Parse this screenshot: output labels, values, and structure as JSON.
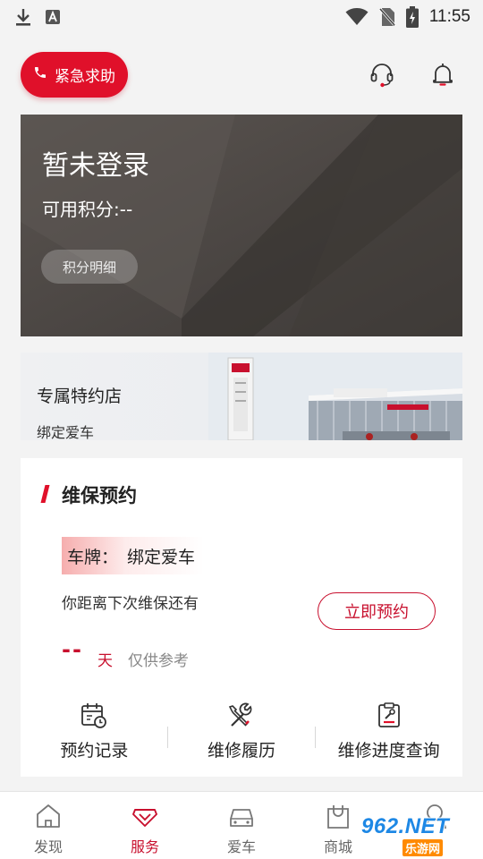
{
  "status_bar": {
    "time": "11:55",
    "icons": [
      "download-icon",
      "a-badge-icon",
      "wifi-icon",
      "no-sim-icon",
      "battery-charging-icon"
    ]
  },
  "header": {
    "sos_label": "紧急求助",
    "icons": [
      "phone-icon",
      "headset-icon",
      "bell-icon"
    ]
  },
  "account": {
    "status": "暂未登录",
    "points_label": "可用积分:--",
    "details_button": "积分明细"
  },
  "dealer": {
    "title": "专属特约店",
    "subtitle": "绑定爱车"
  },
  "maintenance": {
    "title": "维保预约",
    "plate_label": "车牌：",
    "plate_value": "绑定爱车",
    "next_text": "你距离下次维保还有",
    "book_button": "立即预约",
    "days_value": "--",
    "days_unit": "天",
    "days_note": "仅供参考",
    "shortcuts": [
      {
        "label": "预约记录",
        "icon": "calendar-clock-icon"
      },
      {
        "label": "维修履历",
        "icon": "tools-icon"
      },
      {
        "label": "维修进度查询",
        "icon": "clipboard-wrench-icon"
      }
    ]
  },
  "bottom_nav": {
    "active": "服务",
    "items": [
      {
        "label": "发现",
        "icon": "home-icon"
      },
      {
        "label": "服务",
        "icon": "heart-diamond-icon"
      },
      {
        "label": "爱车",
        "icon": "car-icon"
      },
      {
        "label": "商城",
        "icon": "shopping-bag-icon"
      },
      {
        "label": "",
        "icon": "profile-icon"
      }
    ]
  },
  "watermark": {
    "main": "962.NET",
    "sub": "乐游网"
  },
  "colors": {
    "accent": "#e0102a",
    "accent_dark": "#c8102e",
    "card_dark": "#4b4643",
    "background": "#f3f3f3"
  }
}
